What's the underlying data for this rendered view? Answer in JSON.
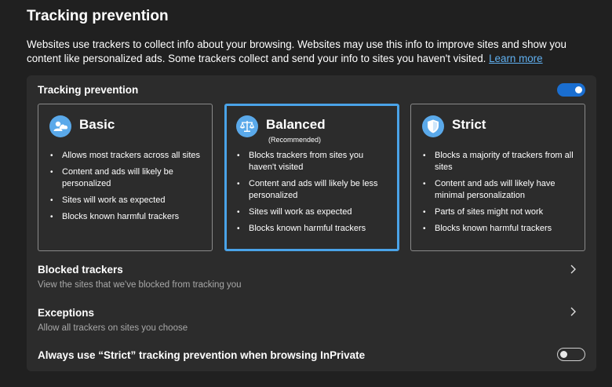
{
  "header": {
    "title": "Tracking prevention",
    "description": "Websites use trackers to collect info about your browsing. Websites may use this info to improve sites and show you content like personalized ads. Some trackers collect and send your info to sites you haven't visited.",
    "learn_more": "Learn more"
  },
  "panel": {
    "title": "Tracking prevention",
    "enabled": true,
    "cards": [
      {
        "title": "Basic",
        "subtitle": "",
        "icon": "cloud-user-icon",
        "selected": false,
        "bullets": [
          "Allows most trackers across all sites",
          "Content and ads will likely be personalized",
          "Sites will work as expected",
          "Blocks known harmful trackers"
        ]
      },
      {
        "title": "Balanced",
        "subtitle": "(Recommended)",
        "icon": "scales-icon",
        "selected": true,
        "bullets": [
          "Blocks trackers from sites you haven't visited",
          "Content and ads will likely be less personalized",
          "Sites will work as expected",
          "Blocks known harmful trackers"
        ]
      },
      {
        "title": "Strict",
        "subtitle": "",
        "icon": "shield-icon",
        "selected": false,
        "bullets": [
          "Blocks a majority of trackers from all sites",
          "Content and ads will likely have minimal personalization",
          "Parts of sites might not work",
          "Blocks known harmful trackers"
        ]
      }
    ],
    "blocked_trackers": {
      "title": "Blocked trackers",
      "description": "View the sites that we've blocked from tracking you"
    },
    "exceptions": {
      "title": "Exceptions",
      "description": "Allow all trackers on sites you choose"
    },
    "inprivate": {
      "title": "Always use “Strict” tracking prevention when browsing InPrivate",
      "enabled": false
    }
  },
  "colors": {
    "background": "#202020",
    "panel": "#2c2c2c",
    "accent": "#1a6ed0",
    "selected_border": "#4aa3e8",
    "link": "#60b0f0"
  }
}
